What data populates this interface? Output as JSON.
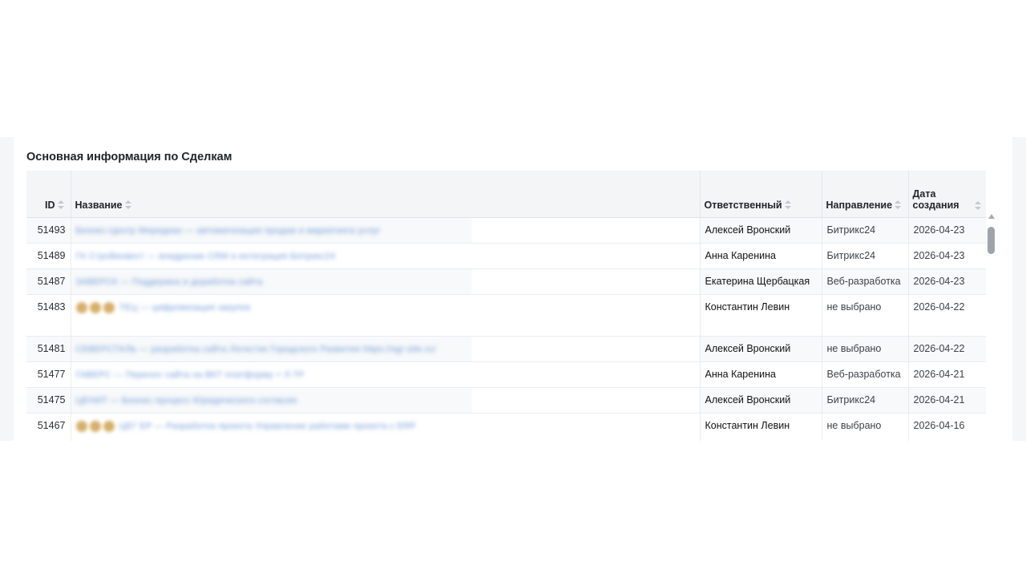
{
  "panel": {
    "title": "Основная информация по Сделкам"
  },
  "table": {
    "headers": {
      "id": "ID",
      "name": "Название",
      "responsible": "Ответственный",
      "direction": "Направление",
      "created_line1": "Дата",
      "created_line2": "создания"
    },
    "rows": [
      {
        "id": "51493",
        "name": "Бизнес-Центр Меридиан — автоматизация продаж и маркетинга услуг",
        "responsible": "Алексей Вронский",
        "direction": "Битрикс24",
        "created": "2026-04-23"
      },
      {
        "id": "51489",
        "name": "ГК Стройинвест — внедрение CRM и интеграция Битрикс24",
        "responsible": "Анна Каренина",
        "direction": "Битрикс24",
        "created": "2026-04-23"
      },
      {
        "id": "51487",
        "name": "ЗАВЕРСК — Поддержка и доработка сайта",
        "responsible": "Екатерина Щербацкая",
        "direction": "Веб-разработка",
        "created": "2026-04-23"
      },
      {
        "id": "51483",
        "name": "ТЕЦ — цифровизация закупок",
        "responsible": "Константин Левин",
        "direction": "не выбрано",
        "created": "2026-04-22",
        "stars": 3
      },
      {
        "id": "51481",
        "name": "СЕВЕРСТАЛЬ — разработка сайта Логистик Городского Развития https://sgr-site.ru/",
        "responsible": "Алексей Вронский",
        "direction": "не выбрано",
        "created": "2026-04-22"
      },
      {
        "id": "51477",
        "name": "ГАВЕРС — Перенос сайта на ВКТ платформу + Л.ТР",
        "responsible": "Анна Каренина",
        "direction": "Веб-разработка",
        "created": "2026-04-21"
      },
      {
        "id": "51475",
        "name": "ЦЕНИТ — Бизнес-процесс Юридического согласия",
        "responsible": "Алексей Вронский",
        "direction": "Битрикс24",
        "created": "2026-04-21"
      },
      {
        "id": "51467",
        "name": "ЦЕГ ЕР — Разработка проекта Управление работами проекта с ERP",
        "responsible": "Константин Левин",
        "direction": "не выбрано",
        "created": "2026-04-16",
        "stars": 3
      }
    ]
  },
  "colors": {
    "link": "#6f99d8",
    "header_bg": "#f3f5f7",
    "band_bg": "#f4f6f8"
  }
}
